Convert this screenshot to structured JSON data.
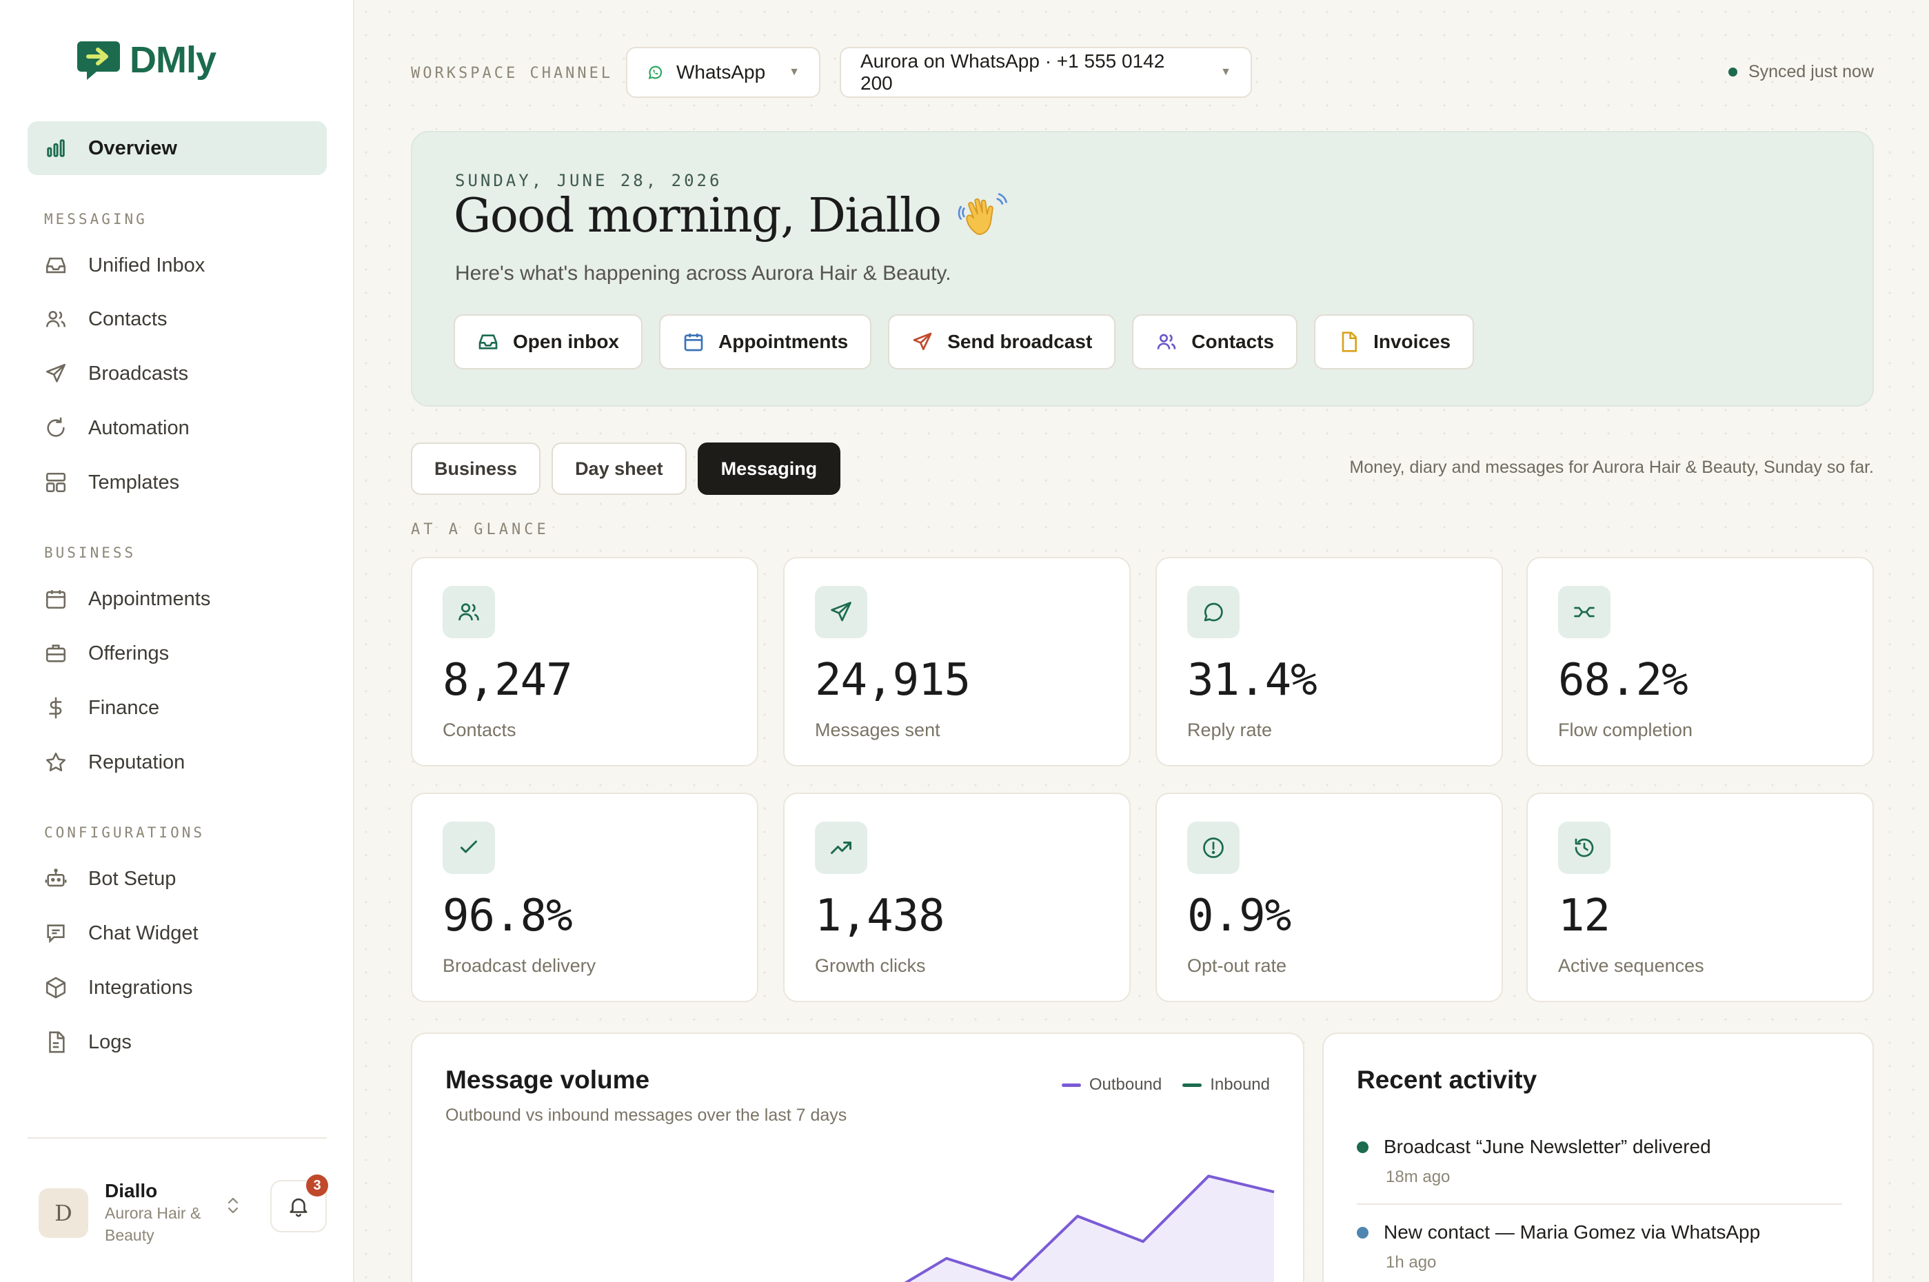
{
  "brand": {
    "name": "DMly"
  },
  "sidebar": {
    "active": "Overview",
    "sections": {
      "messaging": "MESSAGING",
      "business": "BUSINESS",
      "configurations": "CONFIGURATIONS"
    },
    "items": {
      "overview": "Overview",
      "inbox": "Unified Inbox",
      "contacts": "Contacts",
      "broadcasts": "Broadcasts",
      "automation": "Automation",
      "templates": "Templates",
      "appointments": "Appointments",
      "offerings": "Offerings",
      "finance": "Finance",
      "reputation": "Reputation",
      "bot_setup": "Bot Setup",
      "chat_widget": "Chat Widget",
      "integrations": "Integrations",
      "logs": "Logs"
    },
    "user": {
      "initial": "D",
      "name": "Diallo",
      "org": "Aurora Hair & Beauty",
      "notifications": "3"
    }
  },
  "topbar": {
    "label": "WORKSPACE CHANNEL",
    "channel": "WhatsApp",
    "account": "Aurora on WhatsApp · +1 555 0142 200",
    "sync_status": "Synced just now"
  },
  "hero": {
    "date": "SUNDAY, JUNE 28, 2026",
    "greeting": "Good morning, Diallo",
    "subtitle": "Here's what's happening across Aurora Hair & Beauty.",
    "actions": {
      "open_inbox": "Open inbox",
      "appointments": "Appointments",
      "send_broadcast": "Send broadcast",
      "contacts": "Contacts",
      "invoices": "Invoices"
    }
  },
  "tabs": {
    "business": "Business",
    "day_sheet": "Day sheet",
    "messaging": "Messaging",
    "active": "Messaging",
    "note": "Money, diary and messages for Aurora Hair & Beauty, Sunday so far."
  },
  "glance": {
    "label": "AT A GLANCE",
    "stats": [
      {
        "value": "8,247",
        "label": "Contacts",
        "icon": "users-icon"
      },
      {
        "value": "24,915",
        "label": "Messages sent",
        "icon": "send-icon"
      },
      {
        "value": "31.4%",
        "label": "Reply rate",
        "icon": "chat-bubble-icon"
      },
      {
        "value": "68.2%",
        "label": "Flow completion",
        "icon": "flow-icon"
      },
      {
        "value": "96.8%",
        "label": "Broadcast delivery",
        "icon": "check-icon"
      },
      {
        "value": "1,438",
        "label": "Growth clicks",
        "icon": "trending-up-icon"
      },
      {
        "value": "0.9%",
        "label": "Opt-out rate",
        "icon": "alert-circle-icon"
      },
      {
        "value": "12",
        "label": "Active sequences",
        "icon": "history-icon"
      }
    ]
  },
  "message_volume": {
    "title": "Message volume",
    "subtitle": "Outbound vs inbound messages over the last 7 days",
    "legend_outbound": "Outbound",
    "legend_inbound": "Inbound",
    "colors": {
      "outbound": "#7a5bd6",
      "inbound": "#1c6b4f"
    }
  },
  "chart_data": {
    "type": "area",
    "series": [
      {
        "name": "Outbound",
        "values": [
          5,
          42,
          22,
          82,
          58,
          120,
          105
        ]
      }
    ],
    "ylim": [
      0,
      180
    ]
  },
  "recent_activity": {
    "title": "Recent activity",
    "items": [
      {
        "text": "Broadcast “June Newsletter” delivered",
        "time": "18m ago",
        "color": "#1c6b4f"
      },
      {
        "text": "New contact — Maria Gomez via WhatsApp",
        "time": "1h ago",
        "color": "#4f86b0"
      }
    ]
  },
  "colors": {
    "accent": "#1c6b4f",
    "accent_soft": "#e3eee8",
    "dark_tab": "#1e1c19",
    "badge": "#c0492b"
  }
}
